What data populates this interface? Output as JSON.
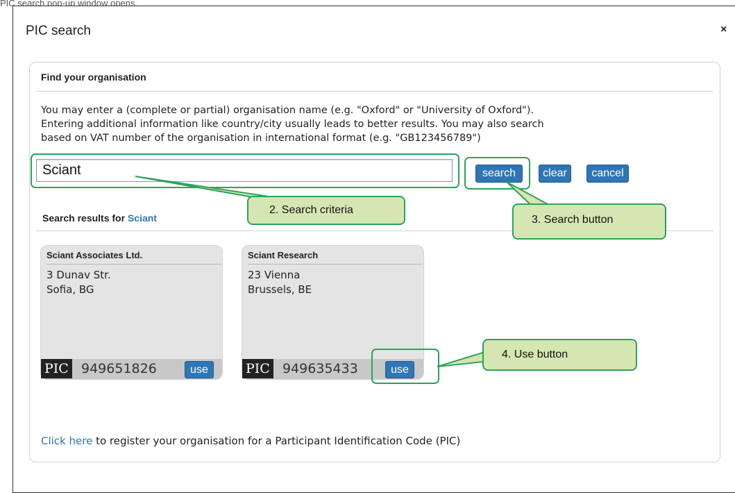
{
  "doc_header": "PIC search pop-up window opens.",
  "dialog": {
    "title": "PIC search",
    "close_icon": "×"
  },
  "find": {
    "title": "Find your organisation",
    "help_line1": "You may enter a (complete or partial) organisation name (e.g. \"Oxford\" or \"University of Oxford\").",
    "help_line2": "Entering additional information like country/city usually leads to better results. You may also search",
    "help_line3": "based on VAT number of the organisation in international format (e.g. \"GB123456789\")",
    "search_value": "Sciant",
    "buttons": {
      "search": "search",
      "clear": "clear",
      "cancel": "cancel"
    }
  },
  "results": {
    "label": "Search results for",
    "term": "Sciant",
    "items": [
      {
        "name": "Sciant Associates Ltd.",
        "address_line1": "3 Dunav Str.",
        "address_line2": "Sofia, BG",
        "pic_label": "PIC",
        "pic_number": "949651826",
        "use_label": "use"
      },
      {
        "name": "Sciant Research",
        "address_line1": "23 Vienna",
        "address_line2": "Brussels, BE",
        "pic_label": "PIC",
        "pic_number": "949635433",
        "use_label": "use"
      }
    ]
  },
  "callouts": {
    "search_criteria": "2. Search criteria",
    "search_button": "3. Search button",
    "use_button": "4. Use button"
  },
  "footer": {
    "link_text": "Click here",
    "rest_text": " to register your organisation for a Participant Identification Code (PIC)"
  },
  "colors": {
    "accent": "#2f76b5",
    "callout_fill": "#d6e6b2",
    "callout_border": "#2aa35a"
  }
}
